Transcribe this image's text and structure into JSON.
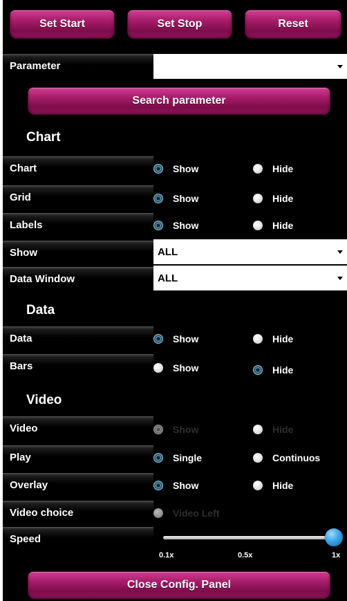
{
  "toolbar": {
    "set_start": "Set Start",
    "set_stop": "Set Stop",
    "reset": "Reset"
  },
  "parameter": {
    "label": "Parameter",
    "value": "",
    "search_button": "Search parameter"
  },
  "sections": {
    "chart": "Chart",
    "data": "Data",
    "video": "Video"
  },
  "rows": {
    "chart": {
      "label": "Chart",
      "opt1": "Show",
      "opt2": "Hide",
      "selected": "Show"
    },
    "grid": {
      "label": "Grid",
      "opt1": "Show",
      "opt2": "Hide",
      "selected": "Show"
    },
    "labels": {
      "label": "Labels",
      "opt1": "Show",
      "opt2": "Hide",
      "selected": "Show"
    },
    "show": {
      "label": "Show",
      "value": "ALL"
    },
    "data_window": {
      "label": "Data Window",
      "value": "ALL"
    },
    "data": {
      "label": "Data",
      "opt1": "Show",
      "opt2": "Hide",
      "selected": "Show"
    },
    "bars": {
      "label": "Bars",
      "opt1": "Show",
      "opt2": "Hide",
      "selected": "Hide"
    },
    "video": {
      "label": "Video",
      "opt1": "Show",
      "opt2": "Hide",
      "disabled": true
    },
    "play": {
      "label": "Play",
      "opt1": "Single",
      "opt2": "Continuos",
      "selected": "Single"
    },
    "overlay": {
      "label": "Overlay",
      "opt1": "Show",
      "opt2": "Hide",
      "selected": "Show"
    },
    "video_choice": {
      "label": "Video choice",
      "opt1": "Video Left",
      "disabled": true
    }
  },
  "speed": {
    "label": "Speed",
    "ticks": [
      "0.1x",
      "0.5x",
      "1x"
    ],
    "value": "1x",
    "level": 1.0
  },
  "close_button": "Close Config. Panel",
  "colors": {
    "button_pink": "#a41a66",
    "panel_bg": "#000000",
    "slider_thumb": "#3aa3e6"
  }
}
